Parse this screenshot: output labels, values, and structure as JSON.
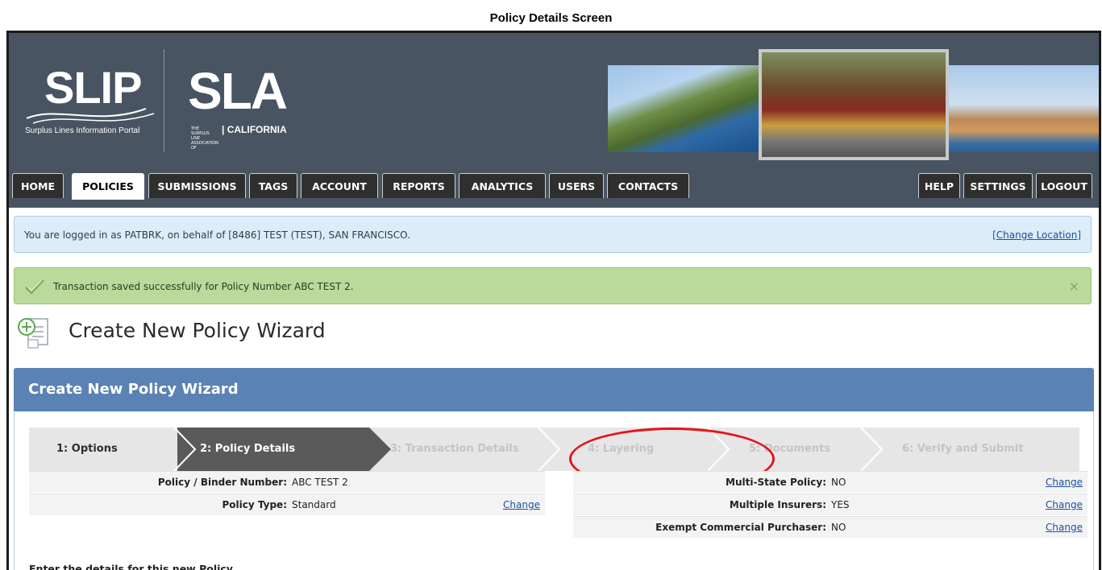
{
  "caption": "Policy Details Screen",
  "branding": {
    "slip_title": "SLIP",
    "slip_subtitle": "Surplus Lines Information Portal",
    "sla_title": "SLA",
    "sla_small_text": "THE SURPLUS LINE ASSOCIATION OF",
    "sla_subtitle": "| CALIFORNIA"
  },
  "nav": {
    "left_tabs": [
      "HOME",
      "POLICIES",
      "SUBMISSIONS",
      "TAGS",
      "ACCOUNT",
      "REPORTS",
      "ANALYTICS",
      "USERS",
      "CONTACTS"
    ],
    "right_tabs": [
      "HELP",
      "SETTINGS",
      "LOGOUT"
    ],
    "active": "POLICIES"
  },
  "info_bar": {
    "text": "You are logged in as PATBRK, on behalf of [8486] TEST (TEST), SAN FRANCISCO.",
    "link": "[Change Location]"
  },
  "success_bar": {
    "text": "Transaction saved successfully for Policy Number ABC TEST 2.",
    "close": "×"
  },
  "page_title": "Create New Policy Wizard",
  "panel": {
    "title": "Create New Policy Wizard",
    "steps": [
      "1: Options",
      "2: Policy Details",
      "3: Transaction Details",
      "4: Layering",
      "5: Documents",
      "6: Verify and Submit"
    ],
    "active_step": 1
  },
  "details_left": [
    {
      "label": "Policy / Binder Number:",
      "value": "ABC TEST 2",
      "action": ""
    },
    {
      "label": "Policy Type:",
      "value": "Standard",
      "action": "Change"
    }
  ],
  "details_right": [
    {
      "label": "Multi-State Policy:",
      "value": "NO",
      "action": "Change"
    },
    {
      "label": "Multiple Insurers:",
      "value": "YES",
      "action": "Change"
    },
    {
      "label": "Exempt Commercial Purchaser:",
      "value": "NO",
      "action": "Change"
    }
  ],
  "instruction": "Enter the details for this new Policy.",
  "colors": {
    "header_bg": "#485462",
    "panel_header": "#5a82b5",
    "success_bg": "#b9da9a",
    "info_bg": "#dcecf9",
    "annotation": "#e4141b"
  }
}
